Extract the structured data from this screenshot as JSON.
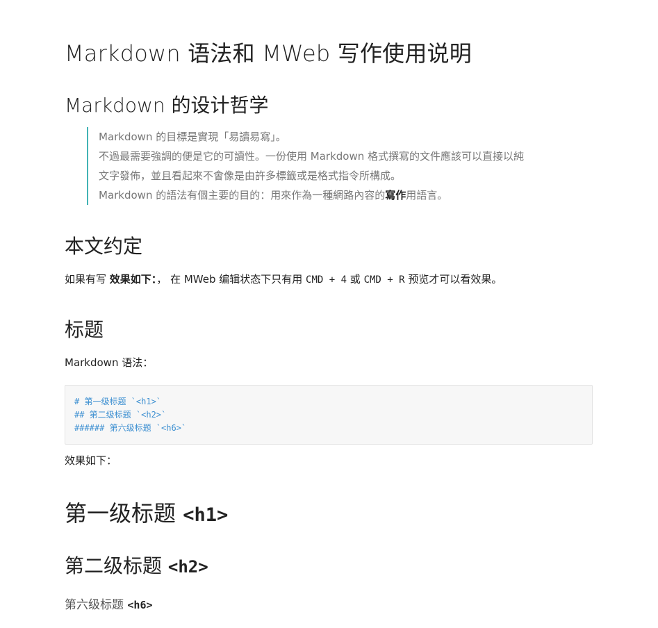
{
  "title": "Markdown 语法和 MWeb 写作使用说明",
  "section_design": {
    "heading": "Markdown 的设计哲学",
    "quote_lines": [
      "Markdown 的目標是實現「易讀易寫」。",
      "不過最需要強調的便是它的可讀性。一份使用 Markdown 格式撰寫的文件應該可以直接以純",
      "文字發佈，並且看起來不會像是由許多標籤或是格式指令所構成。"
    ],
    "quote_last": {
      "before": "Markdown 的語法有個主要的目的：用來作為一種網路內容的",
      "bold": "寫作",
      "after": "用語言。"
    }
  },
  "section_convention": {
    "heading": "本文约定",
    "text_before": "如果有写 ",
    "bold": "效果如下：",
    "text_mid": "， 在 MWeb 编辑状态下只有用 ",
    "code1": "CMD + 4",
    "text_or": " 或 ",
    "code2": "CMD + R",
    "text_after": " 预览才可以看效果。"
  },
  "section_headings": {
    "heading": "标题",
    "intro": "Markdown 语法：",
    "code_lines": [
      "# 第一级标题 `<h1>`",
      "## 第二级标题 `<h2>`",
      "###### 第六级标题 `<h6>`"
    ],
    "result_label": "效果如下：",
    "demo_h1": {
      "text": "第一级标题 ",
      "tag": "<h1>"
    },
    "demo_h2": {
      "text": "第二级标题 ",
      "tag": "<h2>"
    },
    "demo_h6": {
      "text": "第六级标题 ",
      "tag": "<h6>"
    }
  },
  "colors": {
    "quote_border": "#42b3b5",
    "code_text": "#3c8fd1",
    "code_bg": "#f7f7f7"
  }
}
